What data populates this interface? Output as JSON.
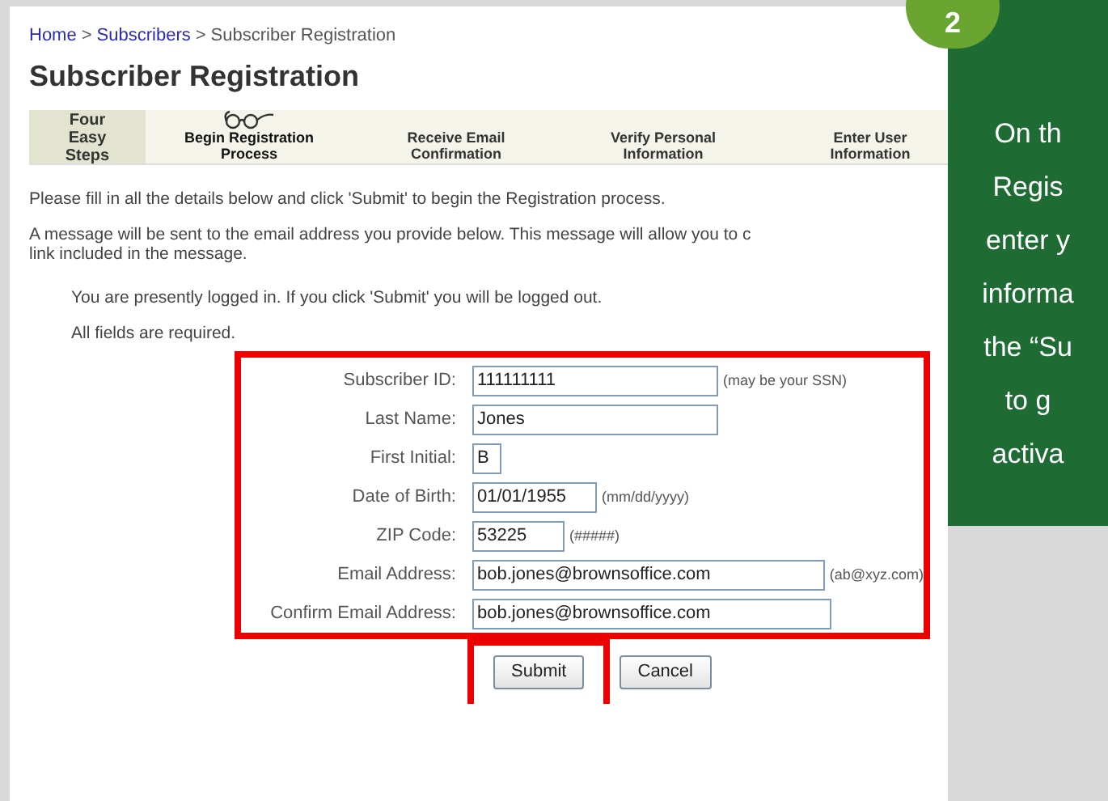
{
  "breadcrumb": [
    "Home",
    "Subscribers",
    "Subscriber Registration"
  ],
  "breadcrumb_separator": ">",
  "title": "Subscriber Registration",
  "steps_header": "Four Easy Steps",
  "steps": [
    {
      "label": "Begin Registration Process",
      "current": true
    },
    {
      "label": "Receive Email Confirmation",
      "current": false
    },
    {
      "label": "Verify Personal Information",
      "current": false
    },
    {
      "label": "Enter User Information",
      "current": false
    }
  ],
  "intro": "Please fill in all the details below and click 'Submit' to begin the Registration process.",
  "message": [
    "A message will be sent to the email address you provide below. This message will allow you to c",
    "link included in the message."
  ],
  "logged_in_note": "You are presently logged in. If you click 'Submit' you will be logged out.",
  "required_note": "All fields are required.",
  "fields": [
    {
      "label": "Subscriber ID:",
      "value": "111111111",
      "hint": "(may be your SSN)"
    },
    {
      "label": "Last Name:",
      "value": "Jones"
    },
    {
      "label": "First Initial:",
      "value": "B"
    },
    {
      "label": "Date of Birth:",
      "value": "01/01/1955",
      "hint": "(mm/dd/yyyy)"
    },
    {
      "label": "ZIP Code:",
      "value": "53225",
      "hint": "(#####)"
    },
    {
      "label": "Email Address:",
      "value": "bob.jones@brownsoffice.com",
      "hint": "(ab@xyz.com)"
    },
    {
      "label": "Confirm Email Address:",
      "value": "bob.jones@brownsoffice.com"
    }
  ],
  "buttons": [
    {
      "label": "Submit",
      "highlighted": true
    },
    {
      "label": "Cancel",
      "highlighted": false
    }
  ],
  "callout": {
    "number": "2",
    "lines": [
      "On th",
      "Regis",
      "enter y",
      "informa",
      "the “Su",
      "to g",
      "activa"
    ]
  }
}
